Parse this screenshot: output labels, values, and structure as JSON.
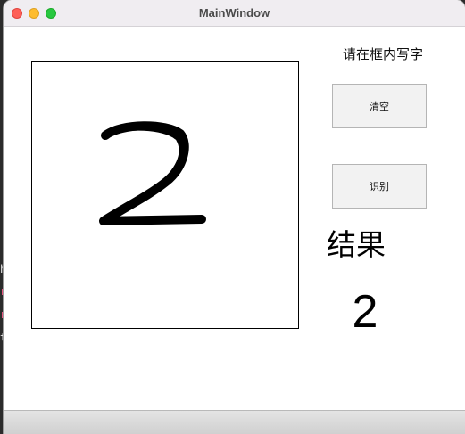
{
  "window": {
    "title": "MainWindow"
  },
  "canvas": {
    "drawn_digit_glyph": "2"
  },
  "sidebar": {
    "prompt": "请在框内写字",
    "clear_button": "清空",
    "recognize_button": "识别",
    "result_label": "结果",
    "result_value": "2"
  },
  "backdrop": {
    "code_chars": [
      "h",
      "r",
      "r",
      "t"
    ],
    "code_colors": [
      "#e6e6e6",
      "#ff5c8a",
      "#ff5c8a",
      "#e6e6e6"
    ]
  },
  "colors": {
    "close": "#fe5f57",
    "minimize": "#febc2e",
    "zoom": "#28c840",
    "stroke": "#000000"
  }
}
